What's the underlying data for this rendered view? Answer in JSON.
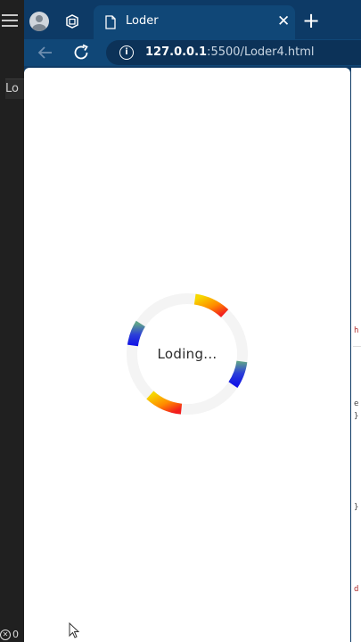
{
  "left_panel": {
    "fragment_top": "Lo",
    "fragment_tab": "Lo",
    "status_count": "0"
  },
  "browser": {
    "tab": {
      "title": "Loder"
    },
    "address": {
      "host": "127.0.0.1",
      "rest": ":5500/Loder4.html"
    }
  },
  "page": {
    "loader_text": "Loding..."
  },
  "devtools": {
    "fragments": [
      "h",
      "e",
      "}",
      "}",
      "d"
    ]
  },
  "colors": {
    "tab_bg": "#104777",
    "tabstrip_bg": "#0d3a66",
    "ring_track": "#f4f4f4"
  }
}
